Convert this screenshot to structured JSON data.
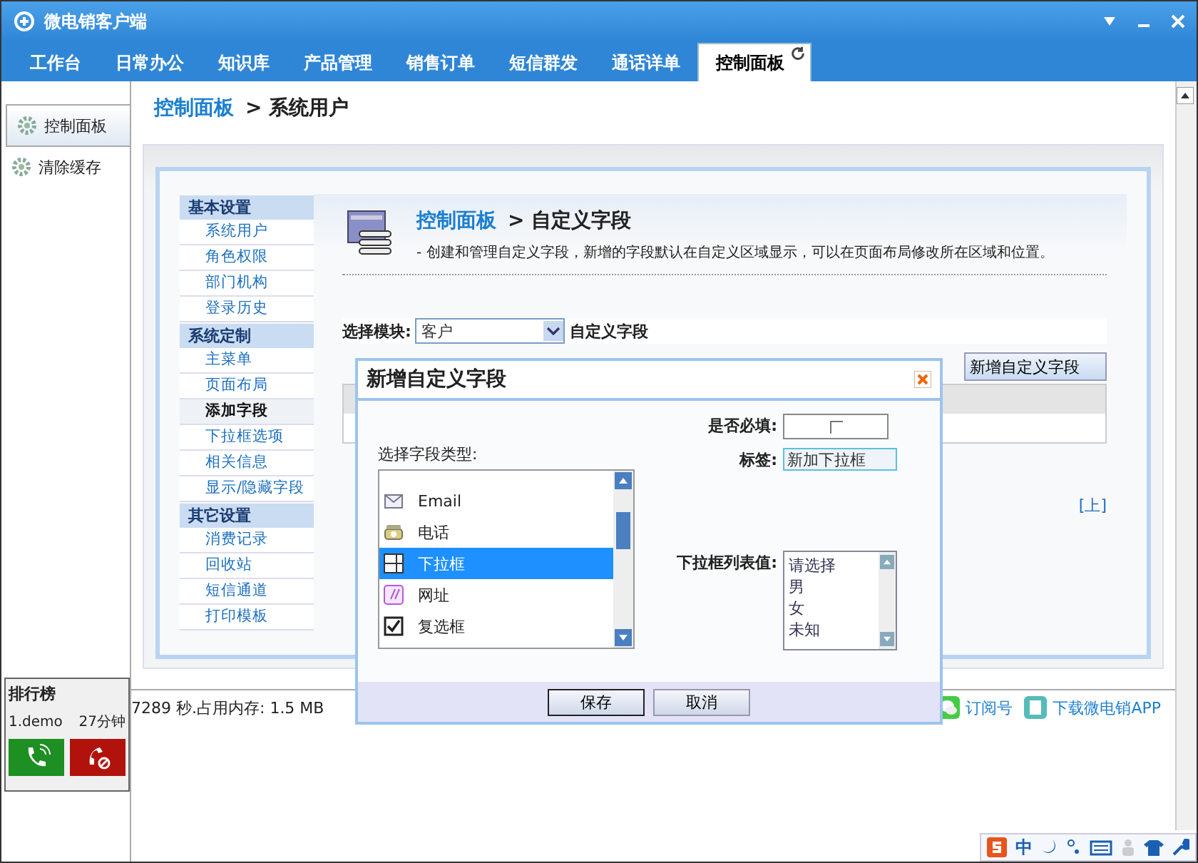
{
  "window": {
    "title": "微电销客户端"
  },
  "tabs": [
    {
      "label": "工作台",
      "selected": false
    },
    {
      "label": "日常办公",
      "selected": false
    },
    {
      "label": "知识库",
      "selected": false
    },
    {
      "label": "产品管理",
      "selected": false
    },
    {
      "label": "销售订单",
      "selected": false
    },
    {
      "label": "短信群发",
      "selected": false
    },
    {
      "label": "通话详单",
      "selected": false
    },
    {
      "label": "控制面板",
      "selected": true
    }
  ],
  "sidebar": {
    "items": [
      {
        "label": "控制面板",
        "selected": true
      },
      {
        "label": "清除缓存",
        "selected": false
      }
    ]
  },
  "breadcrumb": {
    "root": "控制面板",
    "current": "> 系统用户"
  },
  "settings_nav": [
    {
      "title": "基本设置",
      "items": [
        {
          "label": "系统用户",
          "selected": false
        },
        {
          "label": "角色权限",
          "selected": false
        },
        {
          "label": "部门机构",
          "selected": false
        },
        {
          "label": "登录历史",
          "selected": false
        }
      ]
    },
    {
      "title": "系统定制",
      "items": [
        {
          "label": "主菜单",
          "selected": false
        },
        {
          "label": "页面布局",
          "selected": false
        },
        {
          "label": "添加字段",
          "selected": true
        },
        {
          "label": "下拉框选项",
          "selected": false
        },
        {
          "label": "相关信息",
          "selected": false
        },
        {
          "label": "显示/隐藏字段",
          "selected": false
        }
      ]
    },
    {
      "title": "其它设置",
      "items": [
        {
          "label": "消费记录",
          "selected": false
        },
        {
          "label": "回收站",
          "selected": false
        },
        {
          "label": "短信通道",
          "selected": false
        },
        {
          "label": "打印模板",
          "selected": false
        }
      ]
    }
  ],
  "page": {
    "root": "控制面板",
    "current": "> 自定义字段",
    "description": "- 创建和管理自定义字段，新增的字段默认在自定义区域显示，可以在页面布局修改所在区域和位置。",
    "module_label": "选择模块:",
    "module_value": "客户",
    "module_suffix": "自定义字段",
    "add_button": "新增自定义字段",
    "top_link": "[上]"
  },
  "status": {
    "memory": "7289 秒.占用内存: 1.5 MB",
    "links": [
      {
        "kind": "wechat",
        "label": "订阅号"
      },
      {
        "kind": "app",
        "label": "下载微电销APP"
      }
    ]
  },
  "ranking": {
    "title": "排行榜",
    "rows": [
      {
        "name": "1.demo",
        "time": "27分钟"
      }
    ]
  },
  "dialog": {
    "title": "新增自定义字段",
    "type_label": "选择字段类型:",
    "field_types": [
      {
        "kind": "email",
        "label": "Email",
        "selected": false
      },
      {
        "kind": "phone",
        "label": "电话",
        "selected": false
      },
      {
        "kind": "dropdown",
        "label": "下拉框",
        "selected": true
      },
      {
        "kind": "url",
        "label": "网址",
        "selected": false
      },
      {
        "kind": "checkbox",
        "label": "复选框",
        "selected": false
      }
    ],
    "required_label": "是否必填:",
    "required_checked": false,
    "tag_label": "标签:",
    "tag_value": "新加下拉框",
    "options_label": "下拉框列表值:",
    "options": [
      "请选择",
      "男",
      "女",
      "未知"
    ],
    "buttons": [
      "保存",
      "取消"
    ]
  },
  "ime": {
    "mode": "中"
  }
}
